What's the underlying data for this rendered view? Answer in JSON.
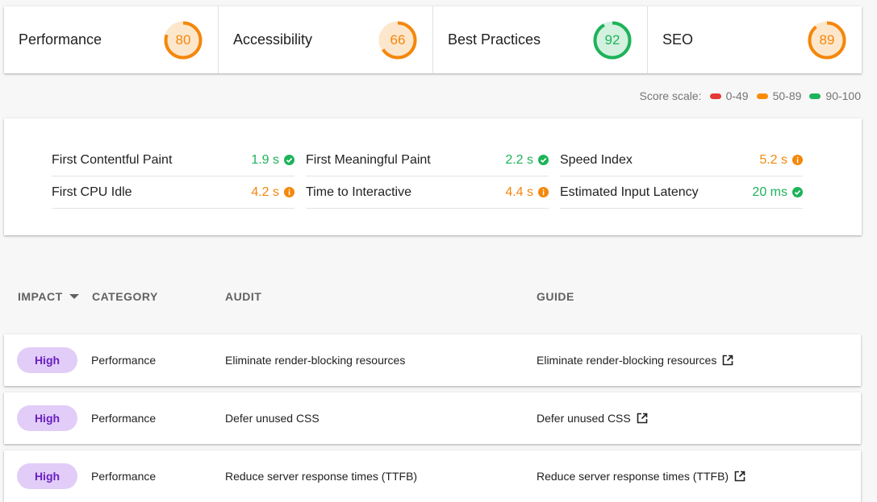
{
  "scores": [
    {
      "name": "Performance",
      "value": "80",
      "score": 80,
      "color": "#f4870b",
      "track": "#fde7cc"
    },
    {
      "name": "Accessibility",
      "value": "66",
      "score": 66,
      "color": "#f4870b",
      "track": "#fde7cc"
    },
    {
      "name": "Best Practices",
      "value": "92",
      "score": 92,
      "color": "#1db35a",
      "track": "#d4f1df"
    },
    {
      "name": "SEO",
      "value": "89",
      "score": 89,
      "color": "#f4870b",
      "track": "#fde7cc"
    }
  ],
  "scale": {
    "label": "Score scale:",
    "ranges": [
      {
        "label": "0-49",
        "color": "#e53935"
      },
      {
        "label": "50-89",
        "color": "#fb8c00"
      },
      {
        "label": "90-100",
        "color": "#1db35a"
      }
    ]
  },
  "metrics": [
    {
      "name": "First Contentful Paint",
      "value": "1.9 s",
      "status": "pass",
      "color": "#1db35a",
      "icon": "check-circle-icon"
    },
    {
      "name": "First Meaningful Paint",
      "value": "2.2 s",
      "status": "pass",
      "color": "#1db35a",
      "icon": "check-circle-icon"
    },
    {
      "name": "Speed Index",
      "value": "5.2 s",
      "status": "average",
      "color": "#f4870b",
      "icon": "info-circle-icon"
    },
    {
      "name": "First CPU Idle",
      "value": "4.2 s",
      "status": "average",
      "color": "#f4870b",
      "icon": "info-circle-icon"
    },
    {
      "name": "Time to Interactive",
      "value": "4.4 s",
      "status": "average",
      "color": "#f4870b",
      "icon": "info-circle-icon"
    },
    {
      "name": "Estimated Input Latency",
      "value": "20 ms",
      "status": "pass",
      "color": "#1db35a",
      "icon": "check-circle-icon"
    }
  ],
  "table": {
    "headers": {
      "impact": "IMPACT",
      "category": "CATEGORY",
      "audit": "AUDIT",
      "guide": "GUIDE"
    },
    "rows": [
      {
        "impact": "High",
        "category": "Performance",
        "audit": "Eliminate render-blocking resources",
        "guide": "Eliminate render-blocking resources"
      },
      {
        "impact": "High",
        "category": "Performance",
        "audit": "Defer unused CSS",
        "guide": "Defer unused CSS"
      },
      {
        "impact": "High",
        "category": "Performance",
        "audit": "Reduce server response times (TTFB)",
        "guide": "Reduce server response times (TTFB)"
      }
    ]
  }
}
